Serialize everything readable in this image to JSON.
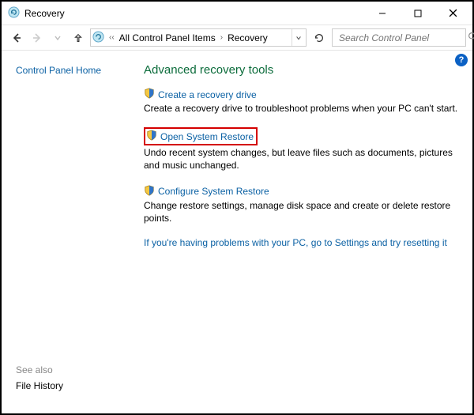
{
  "titlebar": {
    "title": "Recovery"
  },
  "address": {
    "seg1": "All Control Panel Items",
    "seg2": "Recovery"
  },
  "search": {
    "placeholder": "Search Control Panel"
  },
  "sidebar": {
    "home": "Control Panel Home",
    "seealso_label": "See also",
    "file_history": "File History"
  },
  "main": {
    "heading": "Advanced recovery tools",
    "tool1": {
      "link": "Create a recovery drive",
      "desc": "Create a recovery drive to troubleshoot problems when your PC can't start."
    },
    "tool2": {
      "link": "Open System Restore",
      "desc": "Undo recent system changes, but leave files such as documents, pictures and music unchanged."
    },
    "tool3": {
      "link": "Configure System Restore",
      "desc": "Change restore settings, manage disk space and create or delete restore points."
    },
    "settings_link": "If you're having problems with your PC, go to Settings and try resetting it"
  },
  "help": {
    "glyph": "?"
  }
}
